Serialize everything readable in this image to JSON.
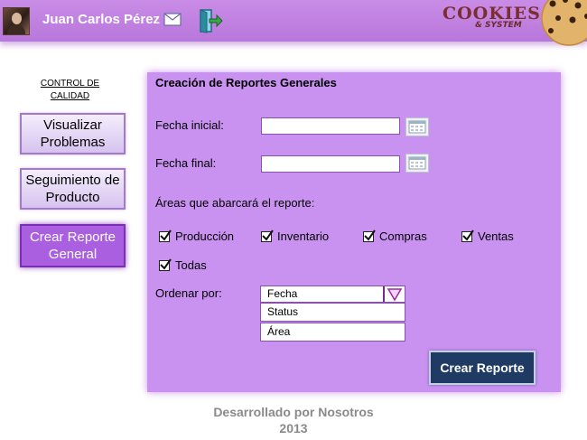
{
  "header": {
    "username": "Juan Carlos Pérez",
    "logo_main": "COOKIES",
    "logo_sub": "& SYSTEM",
    "icons": {
      "avatar": "user-avatar",
      "mail": "mail-icon",
      "logout": "exit-door-icon",
      "cookie": "cookie-icon"
    }
  },
  "sidebar": {
    "title_line1": "CONTROL DE",
    "title_line2": "CALIDAD",
    "items": [
      {
        "line1": "Visualizar",
        "line2": "Problemas",
        "active": false
      },
      {
        "line1": "Seguimiento de",
        "line2": "Producto",
        "active": false
      },
      {
        "line1": "Crear Reporte",
        "line2": "General",
        "active": true
      }
    ]
  },
  "form": {
    "title": "Creación de Reportes Generales",
    "start_date_label": "Fecha inicial:",
    "start_date_value": "",
    "end_date_label": "Fecha final:",
    "end_date_value": "",
    "areas_label": "Áreas que abarcará el reporte:",
    "areas": [
      {
        "label": "Producción",
        "checked": true
      },
      {
        "label": "Inventario",
        "checked": true
      },
      {
        "label": "Compras",
        "checked": true
      },
      {
        "label": "Ventas",
        "checked": true
      },
      {
        "label": "Todas",
        "checked": true
      }
    ],
    "order_label": "Ordenar por:",
    "order_selected": "Fecha",
    "order_options": [
      "Status",
      "Área"
    ],
    "submit_label": "Crear Reporte"
  },
  "footer": {
    "line1": "Desarrollado por Nosotros",
    "line2": "2013"
  },
  "colors": {
    "header": "#c98ce6",
    "panel": "#c992f0",
    "active_menu": "#a95fe0",
    "submit": "#1f3b63"
  }
}
